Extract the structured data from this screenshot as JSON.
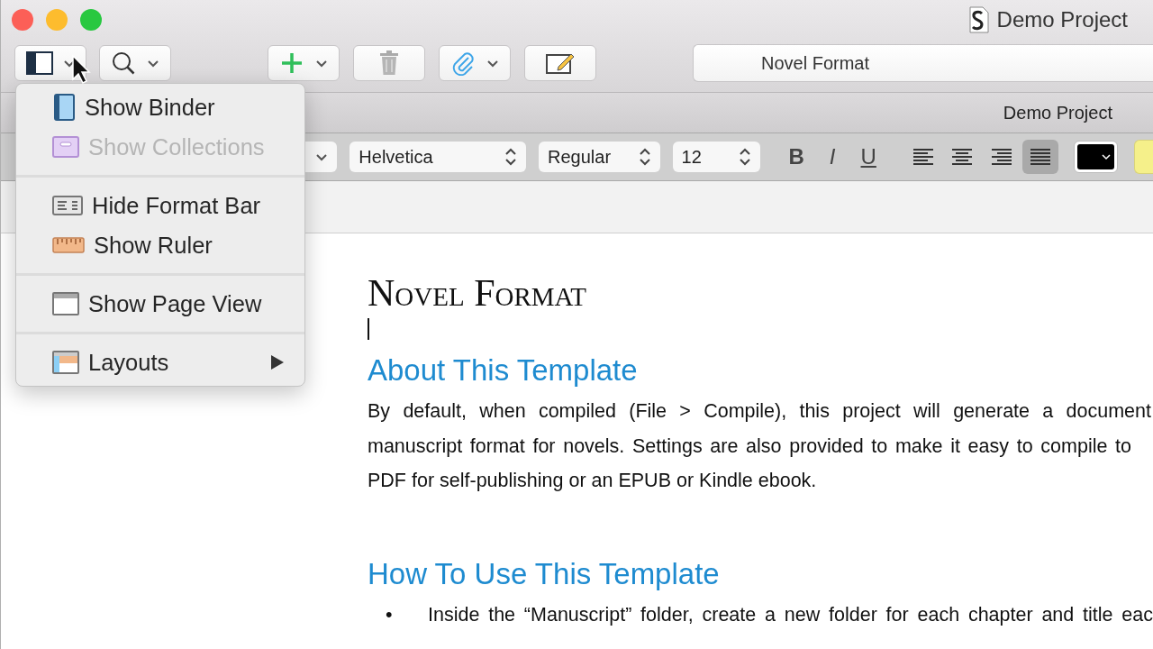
{
  "window": {
    "title": "Demo Project"
  },
  "toolbar": {
    "title_field": "Novel Format"
  },
  "menu": {
    "items": [
      {
        "label": "Show Binder",
        "disabled": false,
        "submenu": false
      },
      {
        "label": "Show Collections",
        "disabled": true,
        "submenu": false
      },
      {
        "kind": "separator"
      },
      {
        "label": "Hide Format Bar",
        "disabled": false,
        "submenu": false
      },
      {
        "label": "Show Ruler",
        "disabled": false,
        "submenu": false
      },
      {
        "kind": "separator"
      },
      {
        "label": "Show Page View",
        "disabled": false,
        "submenu": false
      },
      {
        "kind": "separator"
      },
      {
        "label": "Layouts",
        "disabled": false,
        "submenu": true
      }
    ]
  },
  "header": {
    "title": "Demo Project"
  },
  "format_bar": {
    "font": "Helvetica",
    "style": "Regular",
    "size": "12",
    "bold": "B",
    "italic": "I",
    "underline": "U",
    "alignment": [
      {
        "selected": false
      },
      {
        "selected": false
      },
      {
        "selected": false
      },
      {
        "selected": true
      }
    ]
  },
  "document": {
    "title": "Novel Format",
    "sections": [
      {
        "heading": "About This Template",
        "lines": [
          "By default, when compiled (File > Compile), this project will generate a document",
          "manuscript format for novels. Settings are also provided to make it easy to compile to",
          "PDF for self-publishing or an EPUB or Kindle ebook."
        ]
      },
      {
        "heading": "How To Use This Template",
        "bullets": [
          {
            "marker": "•",
            "text": "Inside the “Manuscript” folder, create a new folder for each chapter and title eac"
          }
        ]
      }
    ]
  }
}
